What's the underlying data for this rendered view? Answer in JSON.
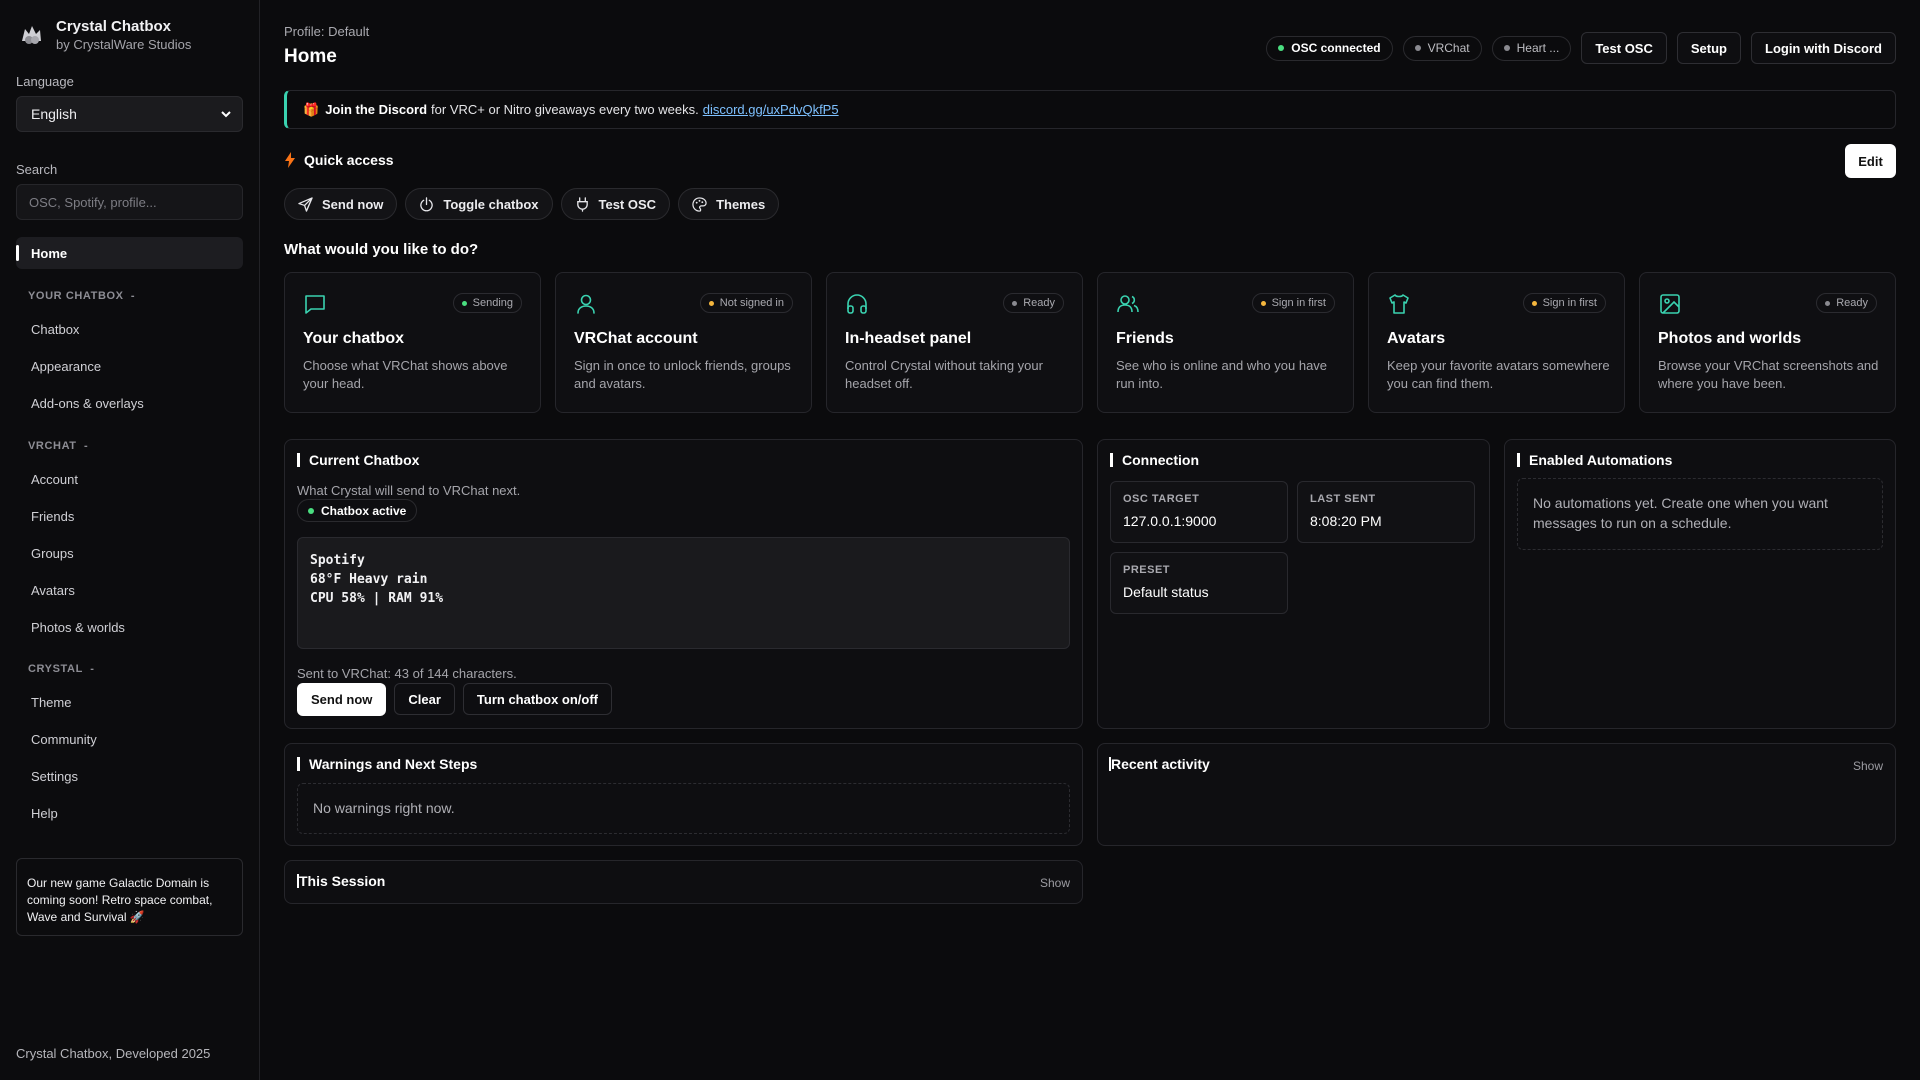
{
  "sidebar": {
    "brand": {
      "title": "Crystal Chatbox",
      "subtitle": "by CrystalWare Studios"
    },
    "language_label": "Language",
    "language_value": "English",
    "search_label": "Search",
    "search_placeholder": "OSC, Spotify, profile...",
    "home": "Home",
    "sections": [
      {
        "title": "YOUR CHATBOX",
        "toggle": "-",
        "items": [
          "Chatbox",
          "Appearance",
          "Add-ons & overlays"
        ]
      },
      {
        "title": "VRCHAT",
        "toggle": "-",
        "items": [
          "Account",
          "Friends",
          "Groups",
          "Avatars",
          "Photos & worlds"
        ]
      },
      {
        "title": "CRYSTAL",
        "toggle": "-",
        "items": [
          "Theme",
          "Community",
          "Settings",
          "Help"
        ]
      }
    ],
    "promo": "Our new game Galactic Domain is coming soon! Retro space combat, Wave and Survival 🚀",
    "footer": "Crystal Chatbox, Developed 2025"
  },
  "header": {
    "profile": "Profile: Default",
    "title": "Home",
    "status": [
      {
        "label": "OSC connected",
        "state": "ok"
      },
      {
        "label": "VRChat",
        "state": "idle"
      },
      {
        "label": "Heart ...",
        "state": "idle"
      }
    ],
    "buttons": {
      "test_osc": "Test OSC",
      "setup": "Setup",
      "login": "Login with Discord"
    }
  },
  "banner": {
    "icon": "🎁",
    "bold": "Join the Discord",
    "text": "for VRC+ or Nitro giveaways every two weeks.",
    "link": "discord.gg/uxPdvQkfP5"
  },
  "quick_access": {
    "title": "Quick access",
    "edit": "Edit",
    "items": [
      {
        "icon": "send-icon",
        "label": "Send now"
      },
      {
        "icon": "power-icon",
        "label": "Toggle chatbox"
      },
      {
        "icon": "plug-icon",
        "label": "Test OSC"
      },
      {
        "icon": "palette-icon",
        "label": "Themes"
      }
    ]
  },
  "tasks": {
    "title": "What would you like to do?",
    "cards": [
      {
        "icon": "chat-icon",
        "badge": "Sending",
        "badge_color": "#4ade80",
        "title": "Your chatbox",
        "desc": "Choose what VRChat shows above your head."
      },
      {
        "icon": "user-icon",
        "badge": "Not signed in",
        "badge_color": "#f5b63d",
        "title": "VRChat account",
        "desc": "Sign in once to unlock friends, groups and avatars."
      },
      {
        "icon": "headset-icon",
        "badge": "Ready",
        "badge_color": "#8a8a90",
        "title": "In-headset panel",
        "desc": "Control Crystal without taking your headset off."
      },
      {
        "icon": "users-icon",
        "badge": "Sign in first",
        "badge_color": "#f5b63d",
        "title": "Friends",
        "desc": "See who is online and who you have run into."
      },
      {
        "icon": "shirt-icon",
        "badge": "Sign in first",
        "badge_color": "#f5b63d",
        "title": "Avatars",
        "desc": "Keep your favorite avatars somewhere you can find them."
      },
      {
        "icon": "image-icon",
        "badge": "Ready",
        "badge_color": "#8a8a90",
        "title": "Photos and worlds",
        "desc": "Browse your VRChat screenshots and where you have been."
      }
    ]
  },
  "current_chatbox": {
    "title": "Current Chatbox",
    "subtitle": "What Crystal will send to VRChat next.",
    "badge": "Chatbox active",
    "lines": [
      "Spotify",
      "68°F Heavy rain",
      "CPU 58% | RAM 91%"
    ],
    "count": "Sent to VRChat: 43 of 144 characters.",
    "buttons": {
      "send": "Send now",
      "clear": "Clear",
      "toggle": "Turn chatbox on/off"
    }
  },
  "connection": {
    "title": "Connection",
    "osc_label": "OSC TARGET",
    "osc_value": "127.0.0.1:9000",
    "sent_label": "LAST SENT",
    "sent_value": "8:08:20 PM",
    "preset_label": "PRESET",
    "preset_value": "Default status"
  },
  "automations": {
    "title": "Enabled Automations",
    "empty": "No automations yet. Create one when you want messages to run on a schedule."
  },
  "warnings": {
    "title": "Warnings and Next Steps",
    "empty": "No warnings right now."
  },
  "recent": {
    "title": "Recent activity",
    "show": "Show"
  },
  "session": {
    "title": "This Session",
    "show": "Show"
  },
  "colors": {
    "accent": "#3ad2b0",
    "ok": "#4ade80",
    "warn": "#f5b63d",
    "bg": "#0b0b0d"
  }
}
